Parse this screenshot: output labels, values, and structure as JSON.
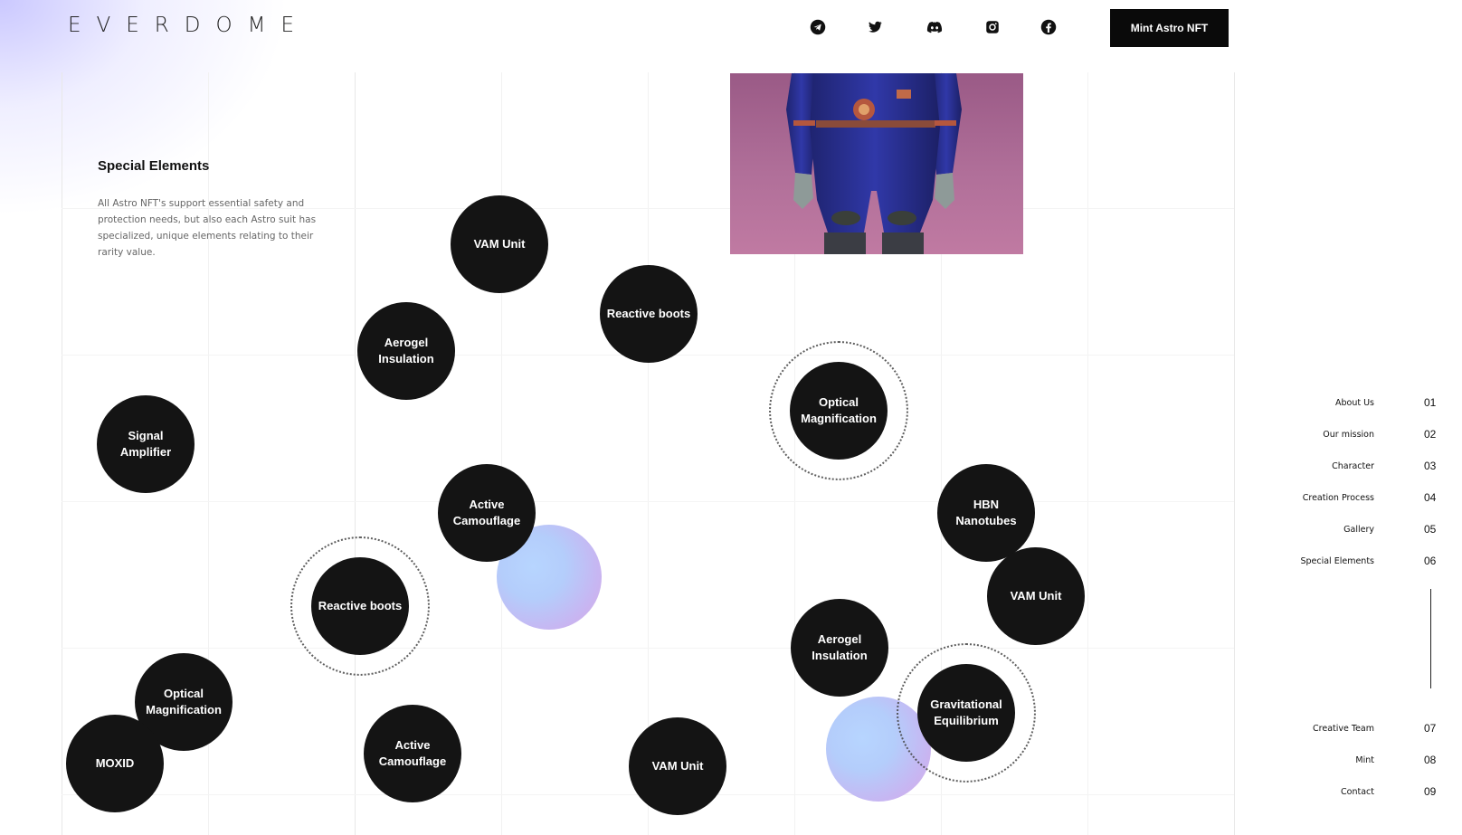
{
  "header": {
    "logo": "EVERDOME",
    "mint_button": "Mint Astro NFT",
    "social": [
      {
        "icon": "telegram-icon"
      },
      {
        "icon": "twitter-icon"
      },
      {
        "icon": "discord-icon"
      },
      {
        "icon": "instagram-icon"
      },
      {
        "icon": "facebook-icon"
      }
    ]
  },
  "intro": {
    "title": "Special Elements",
    "description": "All Astro NFT's support essential safety and protection needs, but also each Astro suit has specialized, unique elements relating to their rarity value."
  },
  "elements": [
    "VAM Unit",
    "Reactive boots",
    "Aerogel Insulation",
    "Optical Magnification",
    "Signal Amplifier",
    "Active Camouflage",
    "HBN Nanotubes",
    "Reactive boots",
    "VAM Unit",
    "Aerogel Insulation",
    "Optical Magnification",
    "Gravitational Equilibrium",
    "MOXID",
    "Active Camouflage",
    "VAM Unit"
  ],
  "side_nav": [
    {
      "label": "About Us",
      "num": "01"
    },
    {
      "label": "Our mission",
      "num": "02"
    },
    {
      "label": "Character",
      "num": "03"
    },
    {
      "label": "Creation Process",
      "num": "04"
    },
    {
      "label": "Gallery",
      "num": "05"
    },
    {
      "label": "Special Elements",
      "num": "06"
    },
    {
      "label": "Creative Team",
      "num": "07"
    },
    {
      "label": "Mint",
      "num": "08"
    },
    {
      "label": "Contact",
      "num": "09"
    }
  ],
  "colors": {
    "bubble": "#141414",
    "accent_orb_blue": "#b7d5ff",
    "accent_orb_pink": "#d9a8e2",
    "character_background": "#b06f99",
    "suit": "#2a2f8e"
  }
}
